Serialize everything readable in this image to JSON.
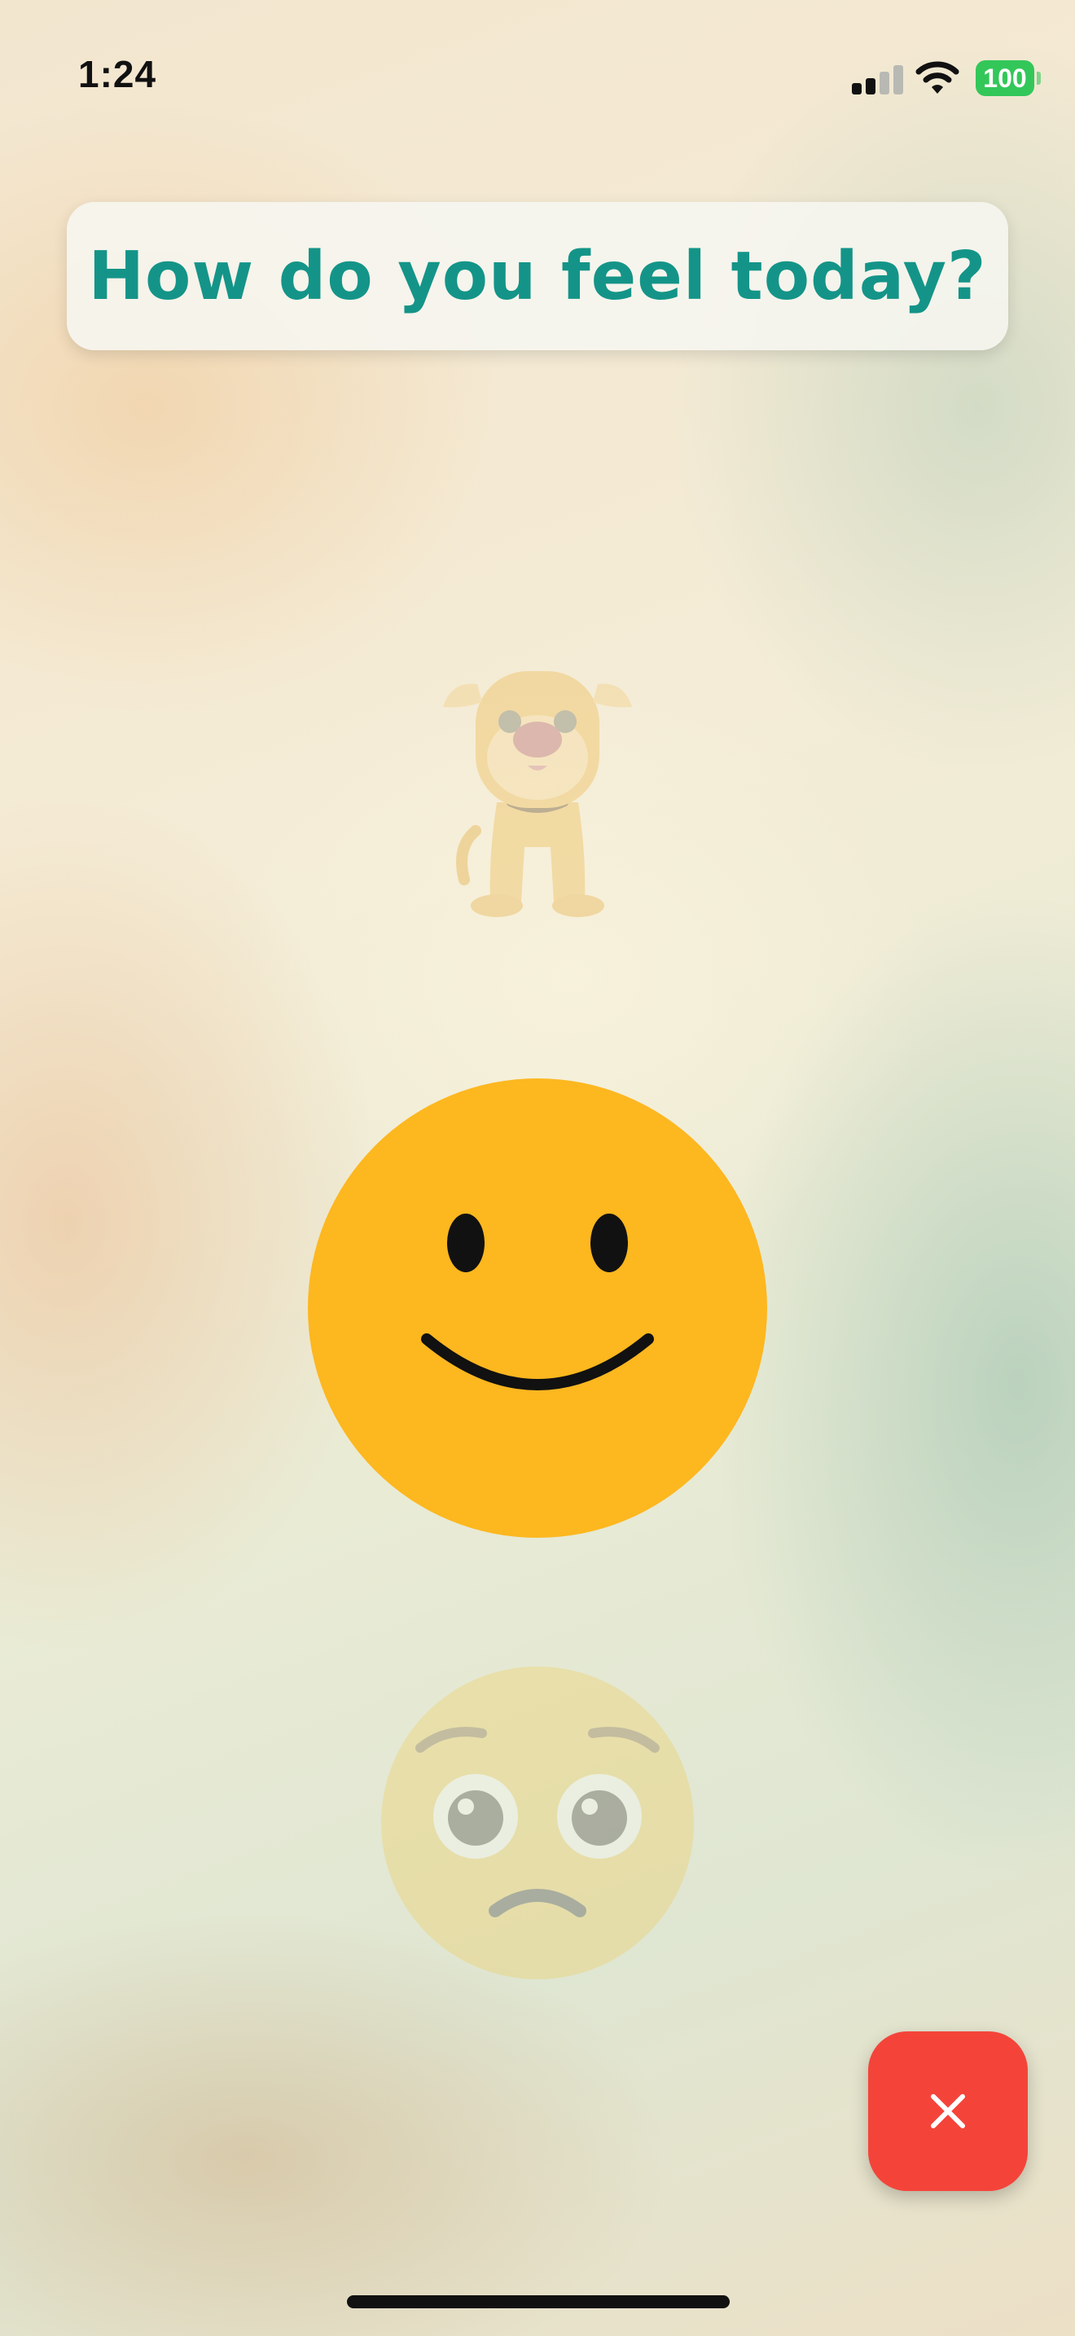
{
  "status_bar": {
    "time": "1:24",
    "battery_level": "100",
    "signal_bars_active": 2,
    "signal_bars_total": 4,
    "wifi": "wifi-icon",
    "battery_color": "#33c759"
  },
  "question": {
    "title": "How do you feel today?",
    "color": "#149488"
  },
  "mood_options": [
    {
      "name": "dog-mascot",
      "state": "faded"
    },
    {
      "name": "happy-face",
      "state": "selected",
      "color": "#fdb71f"
    },
    {
      "name": "worried-face",
      "state": "faded"
    }
  ],
  "close_button": {
    "icon": "close-icon",
    "color": "#f4443a"
  }
}
